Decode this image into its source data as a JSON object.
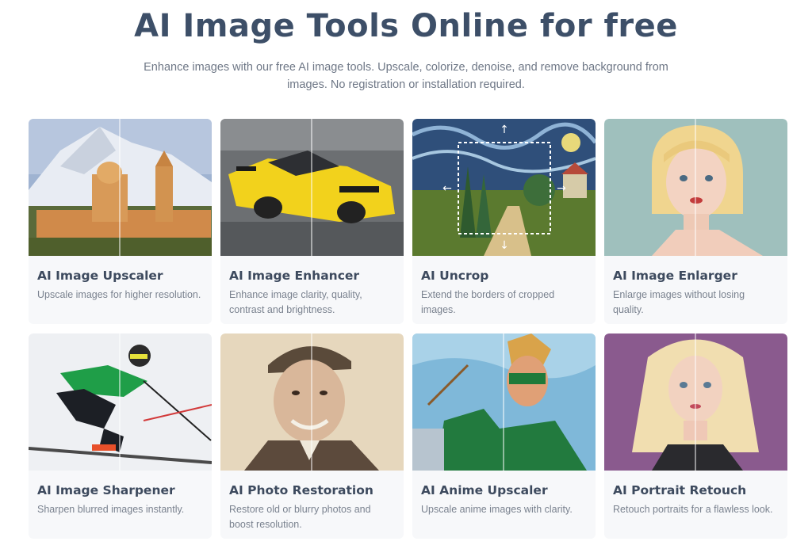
{
  "hero": {
    "title": "AI Image Tools Online for free",
    "subtitle": "Enhance images with our free AI image tools. Upscale, colorize, denoise, and remove background from images. No registration or installation required."
  },
  "tools": [
    {
      "title": "AI Image Upscaler",
      "desc": "Upscale images for higher resolution."
    },
    {
      "title": "AI Image Enhancer",
      "desc": "Enhance image clarity, quality, contrast and brightness."
    },
    {
      "title": "AI Uncrop",
      "desc": "Extend the borders of cropped images."
    },
    {
      "title": "AI Image Enlarger",
      "desc": "Enlarge images without losing quality."
    },
    {
      "title": "AI Image Sharpener",
      "desc": "Sharpen blurred images instantly."
    },
    {
      "title": "AI Photo Restoration",
      "desc": "Restore old or blurry photos and boost resolution."
    },
    {
      "title": "AI Anime Upscaler",
      "desc": "Upscale anime images with clarity."
    },
    {
      "title": "AI Portrait Retouch",
      "desc": "Retouch portraits for a flawless look."
    }
  ]
}
